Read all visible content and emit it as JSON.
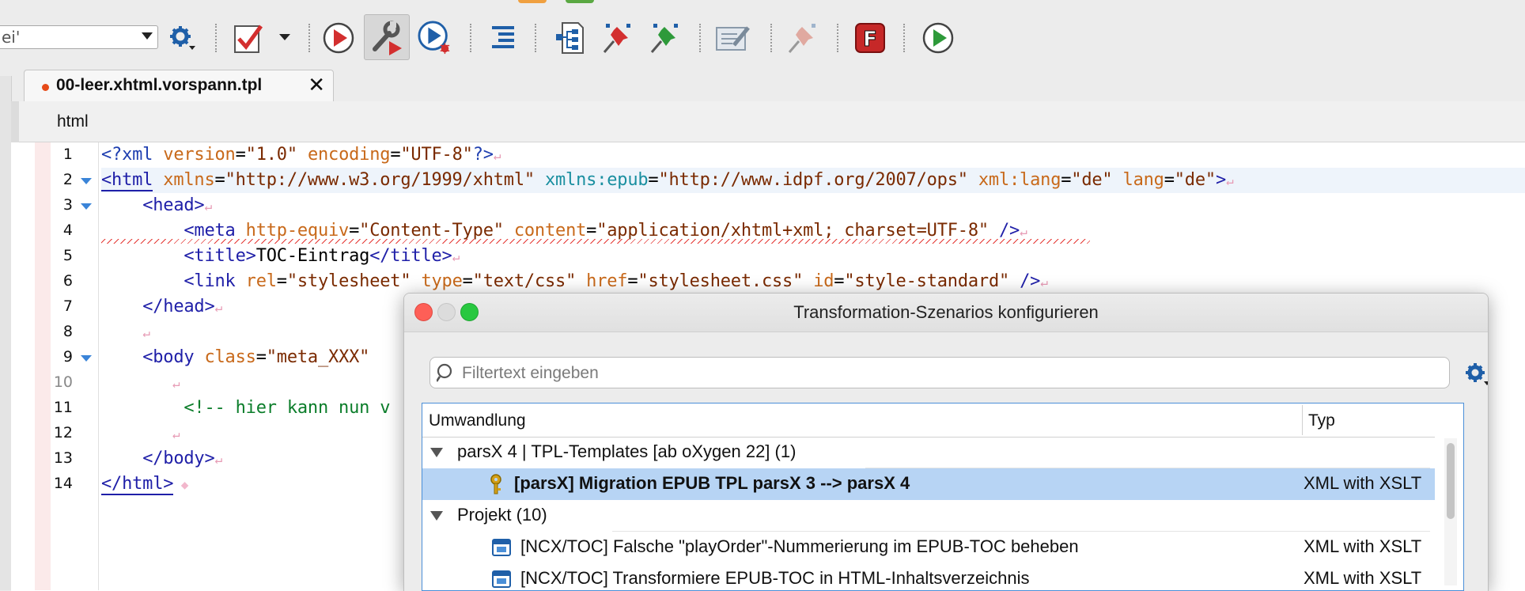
{
  "toolbar": {
    "combo_value": "ei'",
    "icons": [
      "gear-dropdown-icon",
      "validate-check-icon",
      "dropdown-arrow-icon",
      "run-transformation-icon",
      "configure-transformation-icon",
      "debug-scenario-icon",
      "format-indent-icon",
      "xpath-structure-icon",
      "pin-red-icon",
      "pin-green-icon",
      "edit-document-icon",
      "unpin-icon",
      "oxygen-f-icon",
      "run-green-icon"
    ]
  },
  "editor": {
    "tab_label": "00-leer.xhtml.vorspann.tpl",
    "breadcrumb": "html",
    "lines": [
      {
        "n": "1"
      },
      {
        "n": "2"
      },
      {
        "n": "3"
      },
      {
        "n": "4"
      },
      {
        "n": "5"
      },
      {
        "n": "6"
      },
      {
        "n": "7"
      },
      {
        "n": "8"
      },
      {
        "n": "9"
      },
      {
        "n": "10"
      },
      {
        "n": "11"
      },
      {
        "n": "12"
      },
      {
        "n": "13"
      },
      {
        "n": "14"
      }
    ],
    "code": {
      "l1": [
        "<?xml ",
        "version",
        "=",
        "\"1.0\"",
        " ",
        "encoding",
        "=",
        "\"UTF-8\"",
        "?>"
      ],
      "l2": [
        "<html",
        " ",
        "xmlns",
        "=",
        "\"http://www.w3.org/1999/xhtml\"",
        " ",
        "xmlns:epub",
        "=",
        "\"http://www.idpf.org/2007/ops\"",
        " ",
        "xml:lang",
        "=",
        "\"de\"",
        " ",
        "lang",
        "=",
        "\"de\"",
        ">"
      ],
      "l3": [
        "<head>"
      ],
      "l4": [
        "<meta",
        " ",
        "http-equiv",
        "=",
        "\"Content-Type\"",
        " ",
        "content",
        "=",
        "\"application/xhtml+xml; charset=UTF-8\"",
        " />"
      ],
      "l5": [
        "<title>",
        "TOC-Eintrag",
        "</title>"
      ],
      "l6": [
        "<link",
        " ",
        "rel",
        "=",
        "\"stylesheet\"",
        " ",
        "type",
        "=",
        "\"text/css\"",
        " ",
        "href",
        "=",
        "\"stylesheet.css\"",
        " ",
        "id",
        "=",
        "\"style-standard\"",
        " />"
      ],
      "l7": [
        "</head>"
      ],
      "l9": [
        "<body",
        " ",
        "class",
        "=",
        "\"meta_XXX\"",
        " "
      ],
      "l11": [
        "<!-- hier kann nun v"
      ],
      "l13": [
        "</body>"
      ],
      "l14": [
        "</html>"
      ]
    }
  },
  "dialog": {
    "title": "Transformation-Szenarios konfigurieren",
    "filter_placeholder": "Filtertext eingeben",
    "columns": {
      "name": "Umwandlung",
      "type": "Typ"
    },
    "rows": [
      {
        "label": "parsX 4 | TPL-Templates [ab oXygen 22] (1)",
        "type": ""
      },
      {
        "label": "[parsX] Migration EPUB TPL parsX 3 --> parsX 4",
        "type": "XML with XSLT"
      },
      {
        "label": "Projekt (10)",
        "type": ""
      },
      {
        "label": "[NCX/TOC] Falsche \"playOrder\"-Nummerierung im EPUB-TOC beheben",
        "type": "XML with XSLT"
      },
      {
        "label": "[NCX/TOC] Transformiere EPUB-TOC in HTML-Inhaltsverzeichnis",
        "type": "XML with XSLT"
      }
    ]
  }
}
